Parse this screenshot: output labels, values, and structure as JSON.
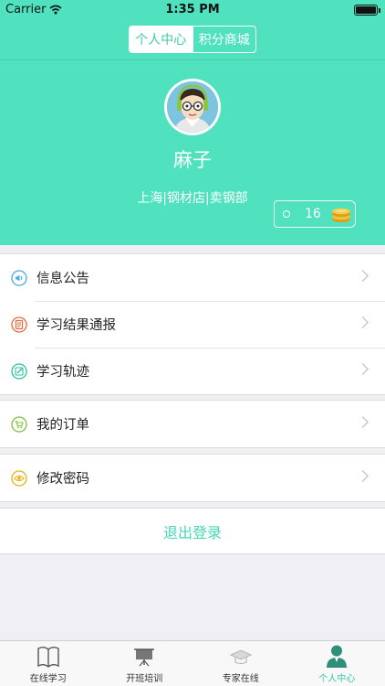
{
  "status_bar": {
    "carrier": "Carrier",
    "time": "1:35 PM"
  },
  "header": {
    "tabs": [
      {
        "label": "个人中心",
        "active": true
      },
      {
        "label": "积分商城",
        "active": false
      }
    ]
  },
  "profile": {
    "name": "麻子",
    "location": "上海|钢材店|卖钢部",
    "points": "16"
  },
  "menu": {
    "group1": [
      {
        "label": "信息公告",
        "icon": "speaker-icon"
      },
      {
        "label": "学习结果通报",
        "icon": "report-icon"
      },
      {
        "label": "学习轨迹",
        "icon": "edit-icon"
      }
    ],
    "group2": [
      {
        "label": "我的订单",
        "icon": "cart-icon"
      }
    ],
    "group3": [
      {
        "label": "修改密码",
        "icon": "eye-icon"
      }
    ]
  },
  "logout_label": "退出登录",
  "tabbar": [
    {
      "label": "在线学习",
      "icon": "book-icon",
      "active": false
    },
    {
      "label": "开班培训",
      "icon": "board-icon",
      "active": false
    },
    {
      "label": "专家在线",
      "icon": "graduation-cap-icon",
      "active": false
    },
    {
      "label": "个人中心",
      "icon": "person-icon",
      "active": true
    }
  ],
  "colors": {
    "accent": "#50e2bf",
    "accent_text": "#3ac7a6",
    "background": "#efeff4"
  }
}
